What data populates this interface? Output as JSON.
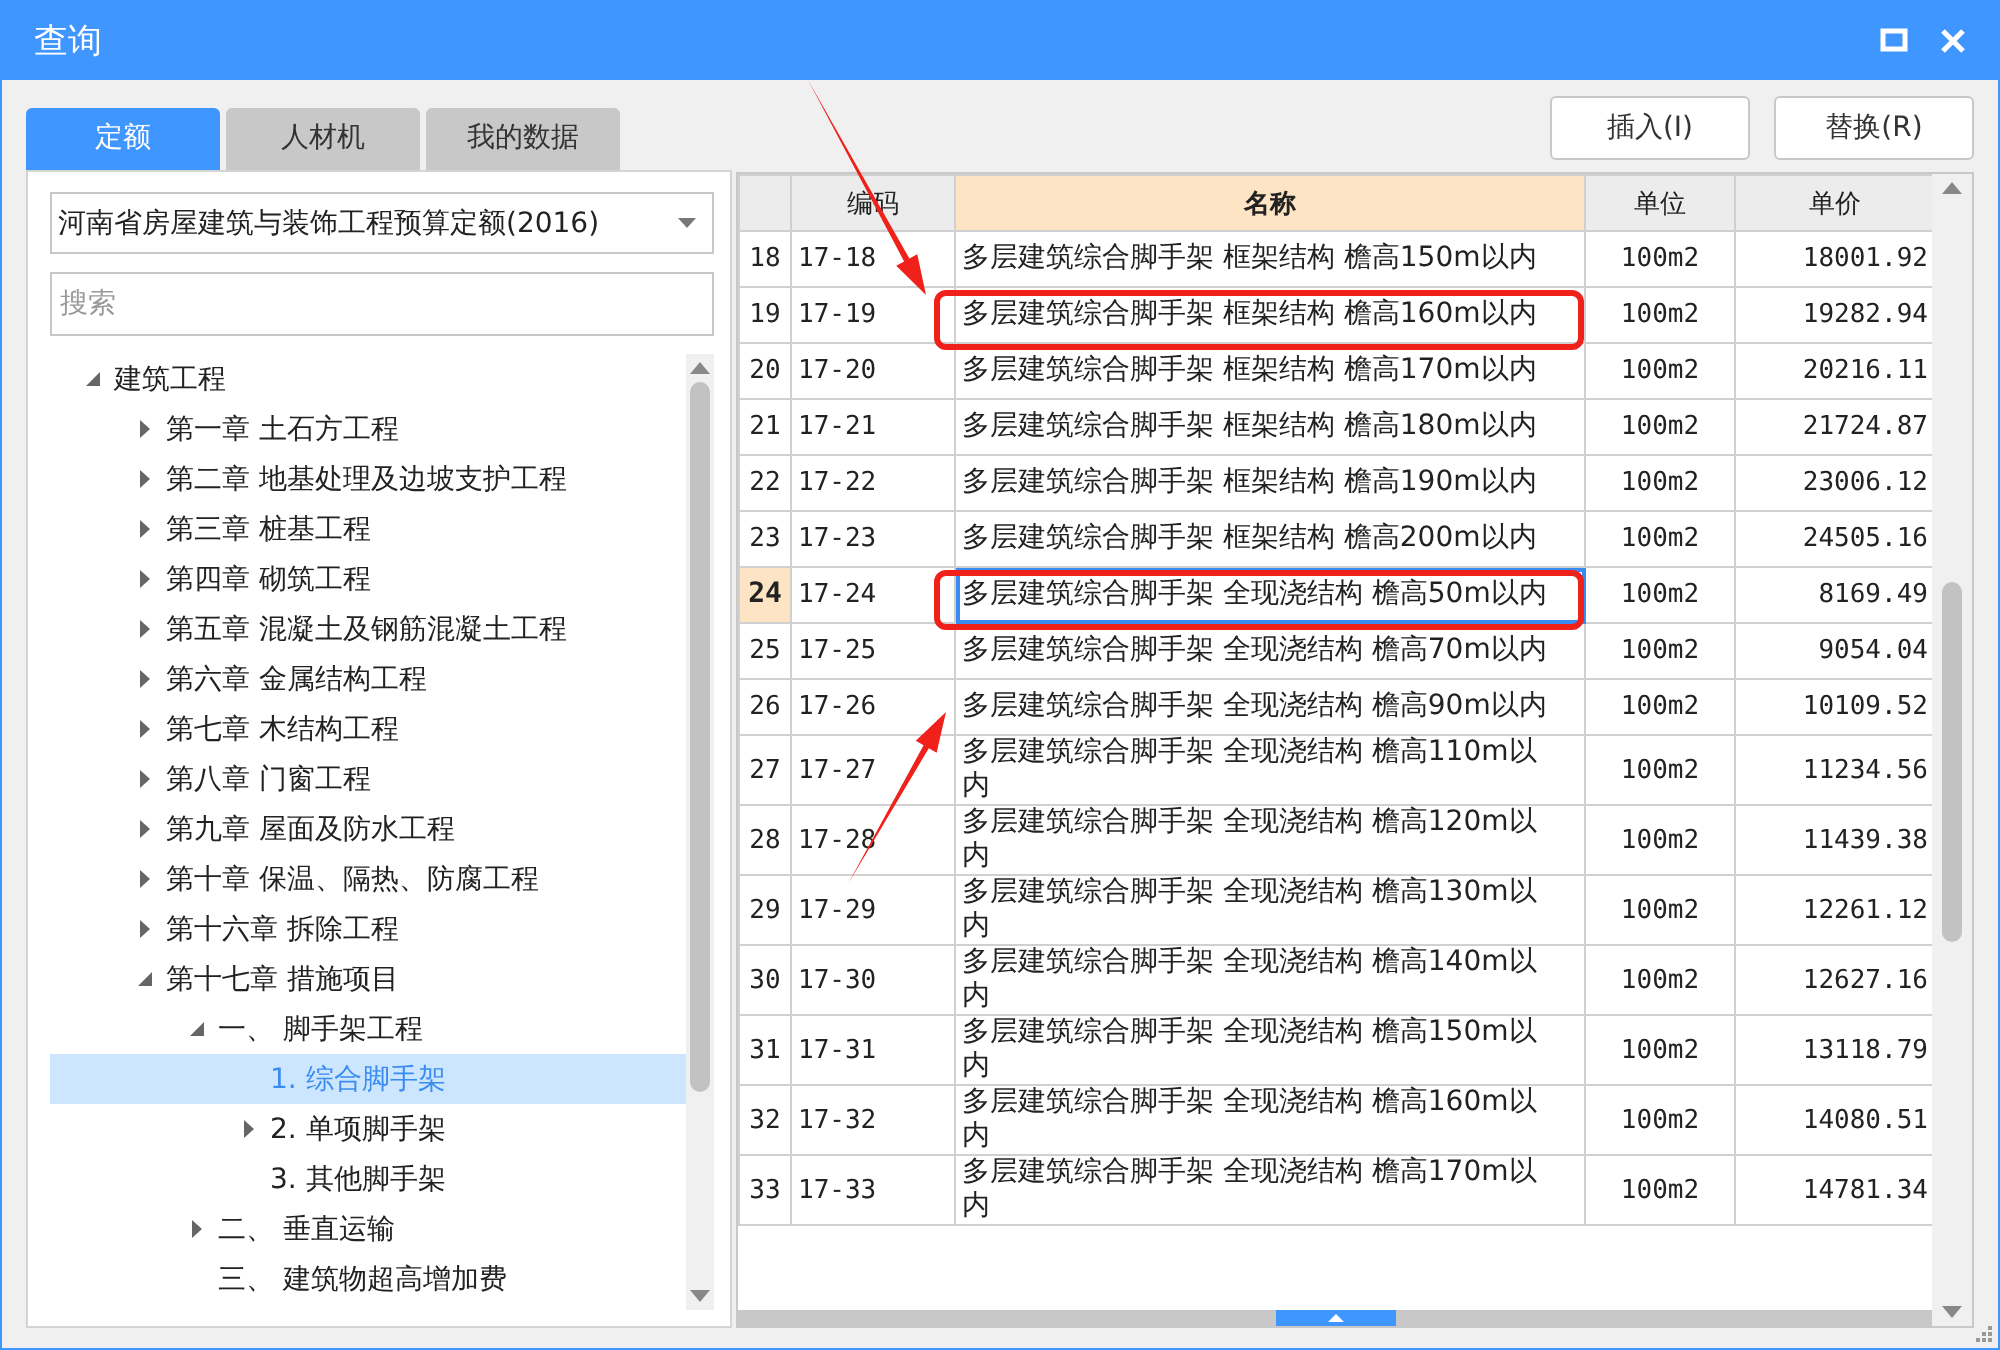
{
  "window": {
    "title": "查询"
  },
  "tabs": [
    {
      "label": "定额",
      "selected": true
    },
    {
      "label": "人材机",
      "selected": false
    },
    {
      "label": "我的数据",
      "selected": false
    }
  ],
  "library_select": {
    "value": "河南省房屋建筑与装饰工程预算定额(2016)"
  },
  "search": {
    "placeholder": "搜索"
  },
  "tree": [
    {
      "label": "建筑工程",
      "expandable": true,
      "expanded": true,
      "selected": false,
      "children": [
        {
          "label": "第一章 土石方工程",
          "expandable": true,
          "expanded": false,
          "selected": false
        },
        {
          "label": "第二章 地基处理及边坡支护工程",
          "expandable": true,
          "expanded": false,
          "selected": false
        },
        {
          "label": "第三章 桩基工程",
          "expandable": true,
          "expanded": false,
          "selected": false
        },
        {
          "label": "第四章 砌筑工程",
          "expandable": true,
          "expanded": false,
          "selected": false
        },
        {
          "label": "第五章 混凝土及钢筋混凝土工程",
          "expandable": true,
          "expanded": false,
          "selected": false
        },
        {
          "label": "第六章 金属结构工程",
          "expandable": true,
          "expanded": false,
          "selected": false
        },
        {
          "label": "第七章 木结构工程",
          "expandable": true,
          "expanded": false,
          "selected": false
        },
        {
          "label": "第八章 门窗工程",
          "expandable": true,
          "expanded": false,
          "selected": false
        },
        {
          "label": "第九章 屋面及防水工程",
          "expandable": true,
          "expanded": false,
          "selected": false
        },
        {
          "label": "第十章 保温、隔热、防腐工程",
          "expandable": true,
          "expanded": false,
          "selected": false
        },
        {
          "label": "第十六章 拆除工程",
          "expandable": true,
          "expanded": false,
          "selected": false
        },
        {
          "label": "第十七章 措施项目",
          "expandable": true,
          "expanded": true,
          "selected": false,
          "children": [
            {
              "label": "一、 脚手架工程",
              "expandable": true,
              "expanded": true,
              "selected": false,
              "children": [
                {
                  "label": "1. 综合脚手架",
                  "expandable": false,
                  "selected": true
                },
                {
                  "label": "2. 单项脚手架",
                  "expandable": true,
                  "expanded": false,
                  "selected": false
                },
                {
                  "label": "3. 其他脚手架",
                  "expandable": false,
                  "selected": false
                }
              ]
            },
            {
              "label": "二、 垂直运输",
              "expandable": true,
              "expanded": false,
              "selected": false
            },
            {
              "label": "三、 建筑物超高增加费",
              "expandable": false,
              "selected": false
            }
          ]
        }
      ]
    }
  ],
  "annotation_arrows": [
    {
      "from_above": true
    },
    {
      "from_above": false
    }
  ],
  "buttons": [
    {
      "label": "插入(I)"
    },
    {
      "label": "替换(R)"
    }
  ],
  "table": {
    "columns": [
      {
        "label": "编码",
        "selected": false
      },
      {
        "label": "名称",
        "selected": true
      },
      {
        "label": "单位",
        "selected": false
      },
      {
        "label": "单价",
        "selected": false
      }
    ],
    "rows": [
      {
        "index": "18",
        "code": "17-18",
        "name": "多层建筑综合脚手架 框架结构 檐高150m以内",
        "unit": "100m2",
        "price": "18001.92",
        "selected": false,
        "highlighted": false
      },
      {
        "index": "19",
        "code": "17-19",
        "name": "多层建筑综合脚手架 框架结构 檐高160m以内",
        "unit": "100m2",
        "price": "19282.94",
        "selected": false,
        "highlighted": true
      },
      {
        "index": "20",
        "code": "17-20",
        "name": "多层建筑综合脚手架 框架结构 檐高170m以内",
        "unit": "100m2",
        "price": "20216.11",
        "selected": false,
        "highlighted": false
      },
      {
        "index": "21",
        "code": "17-21",
        "name": "多层建筑综合脚手架 框架结构 檐高180m以内",
        "unit": "100m2",
        "price": "21724.87",
        "selected": false,
        "highlighted": false
      },
      {
        "index": "22",
        "code": "17-22",
        "name": "多层建筑综合脚手架 框架结构 檐高190m以内",
        "unit": "100m2",
        "price": "23006.12",
        "selected": false,
        "highlighted": false
      },
      {
        "index": "23",
        "code": "17-23",
        "name": "多层建筑综合脚手架 框架结构 檐高200m以内",
        "unit": "100m2",
        "price": "24505.16",
        "selected": false,
        "highlighted": false
      },
      {
        "index": "24",
        "code": "17-24",
        "name": "多层建筑综合脚手架 全现浇结构 檐高50m以内",
        "unit": "100m2",
        "price": "8169.49",
        "selected": true,
        "highlighted": true
      },
      {
        "index": "25",
        "code": "17-25",
        "name": "多层建筑综合脚手架 全现浇结构 檐高70m以内",
        "unit": "100m2",
        "price": "9054.04",
        "selected": false,
        "highlighted": false
      },
      {
        "index": "26",
        "code": "17-26",
        "name": "多层建筑综合脚手架 全现浇结构 檐高90m以内",
        "unit": "100m2",
        "price": "10109.52",
        "selected": false,
        "highlighted": false
      },
      {
        "index": "27",
        "code": "17-27",
        "name": "多层建筑综合脚手架 全现浇结构 檐高110m以内",
        "unit": "100m2",
        "price": "11234.56",
        "selected": false,
        "highlighted": false
      },
      {
        "index": "28",
        "code": "17-28",
        "name": "多层建筑综合脚手架 全现浇结构 檐高120m以内",
        "unit": "100m2",
        "price": "11439.38",
        "selected": false,
        "highlighted": false
      },
      {
        "index": "29",
        "code": "17-29",
        "name": "多层建筑综合脚手架 全现浇结构 檐高130m以内",
        "unit": "100m2",
        "price": "12261.12",
        "selected": false,
        "highlighted": false
      },
      {
        "index": "30",
        "code": "17-30",
        "name": "多层建筑综合脚手架 全现浇结构 檐高140m以内",
        "unit": "100m2",
        "price": "12627.16",
        "selected": false,
        "highlighted": false
      },
      {
        "index": "31",
        "code": "17-31",
        "name": "多层建筑综合脚手架 全现浇结构 檐高150m以内",
        "unit": "100m2",
        "price": "13118.79",
        "selected": false,
        "highlighted": false
      },
      {
        "index": "32",
        "code": "17-32",
        "name": "多层建筑综合脚手架 全现浇结构 檐高160m以内",
        "unit": "100m2",
        "price": "14080.51",
        "selected": false,
        "highlighted": false
      },
      {
        "index": "33",
        "code": "17-33",
        "name": "多层建筑综合脚手架 全现浇结构 檐高170m以内",
        "unit": "100m2",
        "price": "14781.34",
        "selected": false,
        "highlighted": false
      }
    ]
  }
}
